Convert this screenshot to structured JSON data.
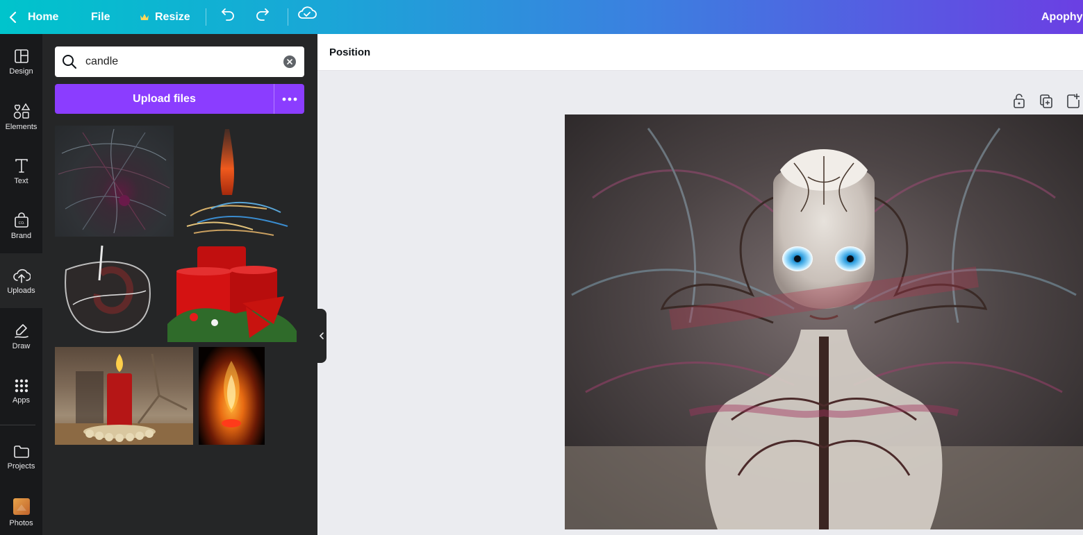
{
  "topbar": {
    "home_label": "Home",
    "file_label": "File",
    "resize_label": "Resize",
    "project_title": "Apophys",
    "icons": {
      "back": "chevron-left-icon",
      "resize": "crown-icon",
      "undo": "undo-icon",
      "redo": "redo-icon",
      "save": "cloud-check-icon"
    }
  },
  "sidebar": {
    "items": [
      {
        "label": "Design",
        "icon": "layout-icon"
      },
      {
        "label": "Elements",
        "icon": "shapes-icon"
      },
      {
        "label": "Text",
        "icon": "text-icon"
      },
      {
        "label": "Brand",
        "icon": "brand-kit-icon"
      },
      {
        "label": "Uploads",
        "icon": "cloud-upload-icon",
        "active": true
      },
      {
        "label": "Draw",
        "icon": "draw-icon"
      },
      {
        "label": "Apps",
        "icon": "apps-grid-icon"
      },
      {
        "label": "Projects",
        "icon": "folder-icon"
      },
      {
        "label": "Photos",
        "icon": "photos-icon"
      }
    ]
  },
  "panel": {
    "search": {
      "value": "candle",
      "icon": "search-icon"
    },
    "upload_label": "Upload files",
    "thumbnails": [
      {
        "name": "fractal-swirl-thumbnail"
      },
      {
        "name": "fractal-flame-thumbnail"
      },
      {
        "name": "glass-fractal-thumbnail"
      },
      {
        "name": "christmas-candles-thumbnail"
      },
      {
        "name": "candle-skulls-thumbnail"
      },
      {
        "name": "flame-dark-thumbnail"
      }
    ]
  },
  "editor": {
    "position_label": "Position",
    "page_tools": [
      "lock-icon",
      "duplicate-page-icon",
      "add-page-icon"
    ],
    "colors": {
      "accent": "#8b3dff",
      "rail_bg": "#18191b",
      "panel_bg": "#252627",
      "canvas_bg": "#ebecf0"
    }
  }
}
